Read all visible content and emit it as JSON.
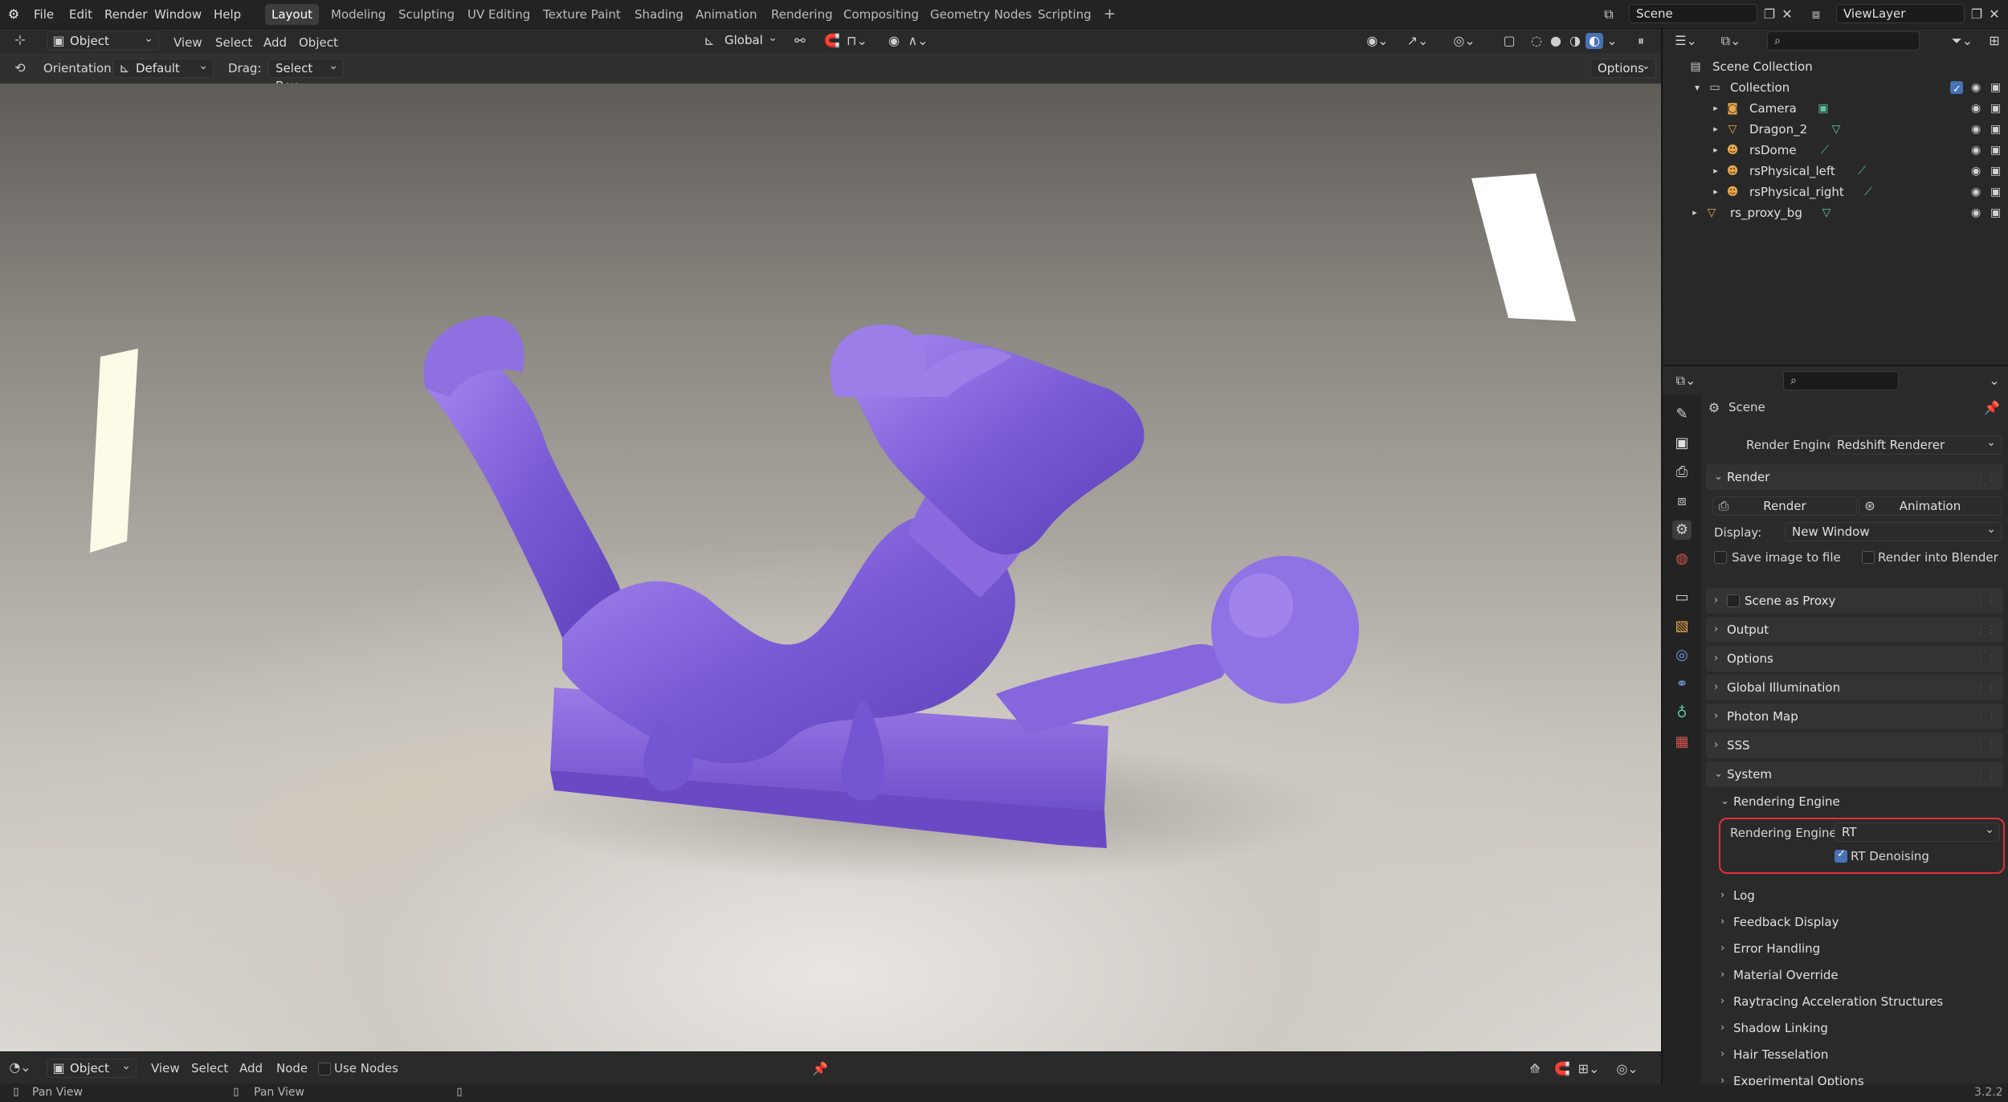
{
  "topbar": {
    "menus": [
      "File",
      "Edit",
      "Render",
      "Window",
      "Help"
    ],
    "workspaces": [
      "Layout",
      "Modeling",
      "Sculpting",
      "UV Editing",
      "Texture Paint",
      "Shading",
      "Animation",
      "Rendering",
      "Compositing",
      "Geometry Nodes",
      "Scripting"
    ],
    "active_workspace": "Layout",
    "add_tab": "+",
    "scene_name": "Scene",
    "view_layer": "ViewLayer"
  },
  "view_header": {
    "mode": "Object Mode",
    "menus": [
      "View",
      "Select",
      "Add",
      "Object"
    ],
    "transform_orientation": "Global"
  },
  "tool_header": {
    "orientation_label": "Orientation:",
    "orientation_value": "Default",
    "drag_label": "Drag:",
    "drag_value": "Select Box",
    "options": "Options"
  },
  "outliner": {
    "root": "Scene Collection",
    "collection": "Collection",
    "items": [
      {
        "name": "Camera",
        "icon": "camera-icon",
        "color": "#e8a54a"
      },
      {
        "name": "Dragon_2",
        "icon": "mesh-icon",
        "color": "#e8a54a"
      },
      {
        "name": "rsDome",
        "icon": "light-icon",
        "color": "#e8a54a"
      },
      {
        "name": "rsPhysical_left",
        "icon": "light-icon",
        "color": "#e8a54a"
      },
      {
        "name": "rsPhysical_right",
        "icon": "light-icon",
        "color": "#e8a54a"
      }
    ],
    "extra": "rs_proxy_bg"
  },
  "properties": {
    "context": "Scene",
    "render_engine_label": "Render Engine",
    "render_engine_value": "Redshift Renderer",
    "render_section": "Render",
    "render_button": "Render",
    "animation_button": "Animation",
    "display_label": "Display:",
    "display_value": "New Window",
    "save_image_label": "Save image to file",
    "render_into_blender_label": "Render into Blender",
    "sections": [
      "Scene as Proxy",
      "Output",
      "Options",
      "Global Illumination",
      "Photon Map",
      "SSS"
    ],
    "system_section": "System",
    "rendering_engine_sub": "Rendering Engine",
    "rt_engine_label": "Rendering Engine",
    "rt_engine_value": "RT",
    "rt_denoising_label": "RT Denoising",
    "subsections": [
      "Log",
      "Feedback Display",
      "Error Handling",
      "Material Override",
      "Raytracing Acceleration Structures",
      "Shadow Linking",
      "Hair Tesselation",
      "Experimental Options"
    ]
  },
  "bottom_header": {
    "mode": "Object",
    "menus": [
      "View",
      "Select",
      "Add",
      "Node"
    ],
    "use_nodes_label": "Use Nodes"
  },
  "status": {
    "left_hint": "Pan View",
    "middle_hint": "Pan View",
    "version": "3.2.2"
  },
  "colors": {
    "accent": "#4772b3",
    "highlight": "#e0303a",
    "dragon": "#7a5bd6"
  }
}
